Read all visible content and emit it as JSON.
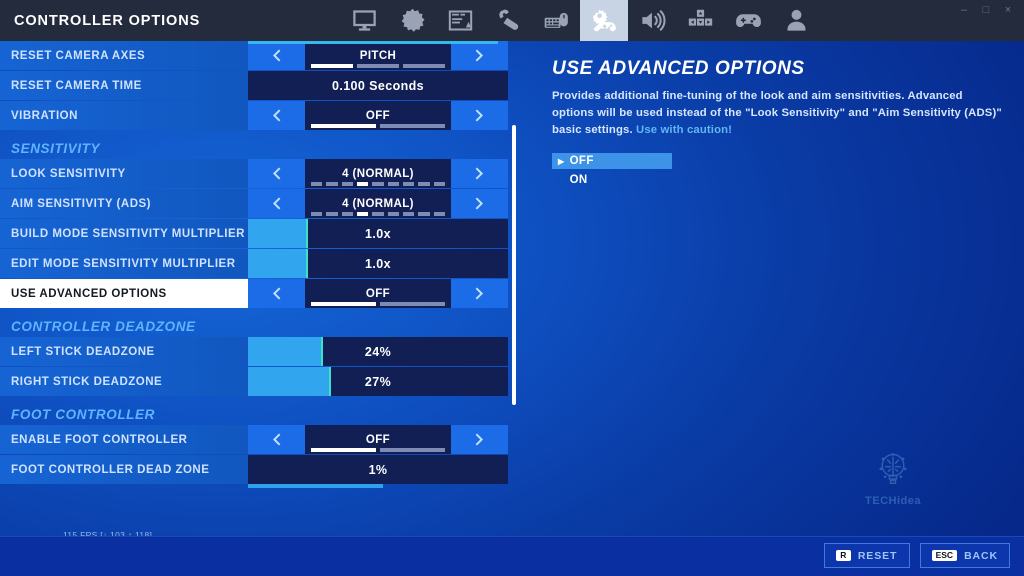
{
  "window": {
    "title": "CONTROLLER OPTIONS",
    "minimize": "–",
    "maximize": "□",
    "close": "×"
  },
  "nav": {
    "items": [
      {
        "icon": "monitor-icon",
        "label": "Video",
        "active": false
      },
      {
        "icon": "gear-icon",
        "label": "Game",
        "active": false
      },
      {
        "icon": "hud-layout-icon",
        "label": "HUD",
        "active": false
      },
      {
        "icon": "touch-input-icon",
        "label": "Touch",
        "active": false
      },
      {
        "icon": "keyboard-mouse-icon",
        "label": "Keyboard and Mouse",
        "active": false
      },
      {
        "icon": "controller-options-icon",
        "label": "Controller Options",
        "active": true
      },
      {
        "icon": "audio-icon",
        "label": "Audio",
        "active": false
      },
      {
        "icon": "keybinds-icon",
        "label": "Keybinds",
        "active": false
      },
      {
        "icon": "gamepad-icon",
        "label": "Controller Config",
        "active": false
      },
      {
        "icon": "account-icon",
        "label": "Account",
        "active": false
      }
    ]
  },
  "settings": {
    "rows": [
      {
        "id": "reset-camera-axes",
        "label": "RESET CAMERA AXES",
        "value": "PITCH",
        "type": "stepper",
        "segments": 3,
        "active_segment": 0,
        "selected": false
      },
      {
        "id": "reset-camera-time",
        "label": "RESET CAMERA TIME",
        "value": "0.100 Seconds",
        "type": "value",
        "selected": false
      },
      {
        "id": "vibration",
        "label": "VIBRATION",
        "value": "OFF",
        "type": "stepper",
        "segments": 2,
        "active_segment": 0,
        "selected": false
      }
    ],
    "section_sensitivity": "SENSITIVITY",
    "sensitivity_rows": [
      {
        "id": "look-sensitivity",
        "label": "LOOK SENSITIVITY",
        "value": "4 (NORMAL)",
        "type": "stepper",
        "segments": 9,
        "active_segment": 3,
        "selected": false
      },
      {
        "id": "aim-sensitivity-ads",
        "label": "AIM SENSITIVITY (ADS)",
        "value": "4 (NORMAL)",
        "type": "stepper",
        "segments": 9,
        "active_segment": 3,
        "selected": false
      },
      {
        "id": "build-mode-sensitivity-multiplier",
        "label": "BUILD MODE SENSITIVITY MULTIPLIER",
        "value": "1.0x",
        "type": "slider",
        "fill_percent": 23,
        "selected": false
      },
      {
        "id": "edit-mode-sensitivity-multiplier",
        "label": "EDIT MODE SENSITIVITY MULTIPLIER",
        "value": "1.0x",
        "type": "slider",
        "fill_percent": 23,
        "selected": false
      },
      {
        "id": "use-advanced-options",
        "label": "USE ADVANCED OPTIONS",
        "value": "OFF",
        "type": "stepper",
        "segments": 2,
        "active_segment": 0,
        "selected": true
      }
    ],
    "section_deadzone": "CONTROLLER DEADZONE",
    "deadzone_rows": [
      {
        "id": "left-stick-deadzone",
        "label": "LEFT STICK DEADZONE",
        "value": "24%",
        "type": "slider",
        "fill_percent": 29,
        "selected": false
      },
      {
        "id": "right-stick-deadzone",
        "label": "RIGHT STICK DEADZONE",
        "value": "27%",
        "type": "slider",
        "fill_percent": 32,
        "selected": false
      }
    ],
    "section_foot": "FOOT CONTROLLER",
    "foot_rows": [
      {
        "id": "enable-foot-controller",
        "label": "ENABLE FOOT CONTROLLER",
        "value": "OFF",
        "type": "stepper",
        "segments": 2,
        "active_segment": 0,
        "selected": false
      },
      {
        "id": "foot-controller-dead-zone",
        "label": "FOOT CONTROLLER DEAD ZONE",
        "value": "1%",
        "type": "value-underline",
        "fill_percent": 52,
        "selected": false
      }
    ]
  },
  "detail": {
    "title": "USE ADVANCED OPTIONS",
    "description": "Provides additional fine-tuning of the look and aim sensitivities.  Advanced options will be used instead of the \"Look Sensitivity\" and \"Aim Sensitivity (ADS)\" basic settings. ",
    "caution": "Use with caution!",
    "options": [
      {
        "label": "OFF",
        "selected": true
      },
      {
        "label": "ON",
        "selected": false
      }
    ]
  },
  "watermark": {
    "text": "TECHidea",
    "icon": "lightbulb-gear-icon"
  },
  "status": {
    "fps": "115 FPS [↓ 103 ↑ 118]"
  },
  "bottom": {
    "reset_key": "R",
    "reset_label": "RESET",
    "back_key": "ESC",
    "back_label": "BACK"
  },
  "colors": {
    "accent_blue": "#1c6ce8",
    "slider_fill": "#31a6ef",
    "selected_row": "#ffffff",
    "section_header": "#5fb4ff",
    "caution": "#61b6f5"
  }
}
